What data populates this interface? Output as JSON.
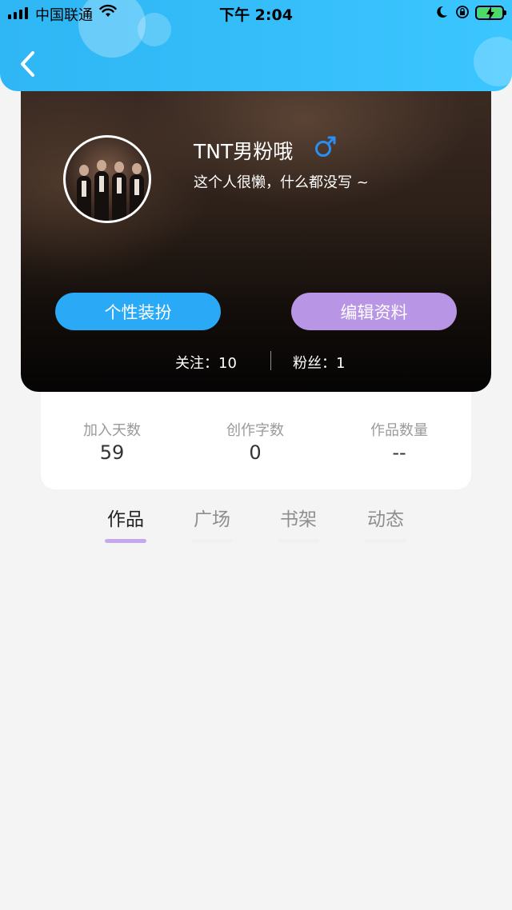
{
  "status_bar": {
    "carrier": "中国联通",
    "time": "下午 2:04"
  },
  "profile": {
    "username": "TNT男粉哦",
    "gender_icon": "male-icon",
    "bio": "这个人很懒，什么都没写 ~",
    "customize_label": "个性装扮",
    "edit_label": "编辑资料",
    "following_text": "关注：10",
    "fans_text": "粉丝：1"
  },
  "stats": [
    {
      "label": "加入天数",
      "value": "59"
    },
    {
      "label": "创作字数",
      "value": "0"
    },
    {
      "label": "作品数量",
      "value": "--"
    }
  ],
  "tabs": [
    {
      "label": "作品",
      "active": true
    },
    {
      "label": "广场",
      "active": false
    },
    {
      "label": "书架",
      "active": false
    },
    {
      "label": "动态",
      "active": false
    }
  ],
  "colors": {
    "header": "#35befa",
    "customize_button": "#2aa9f7",
    "edit_button": "#b995e6",
    "active_tab_underline": "#c5a8ee",
    "gender_icon": "#2a8ff0"
  }
}
